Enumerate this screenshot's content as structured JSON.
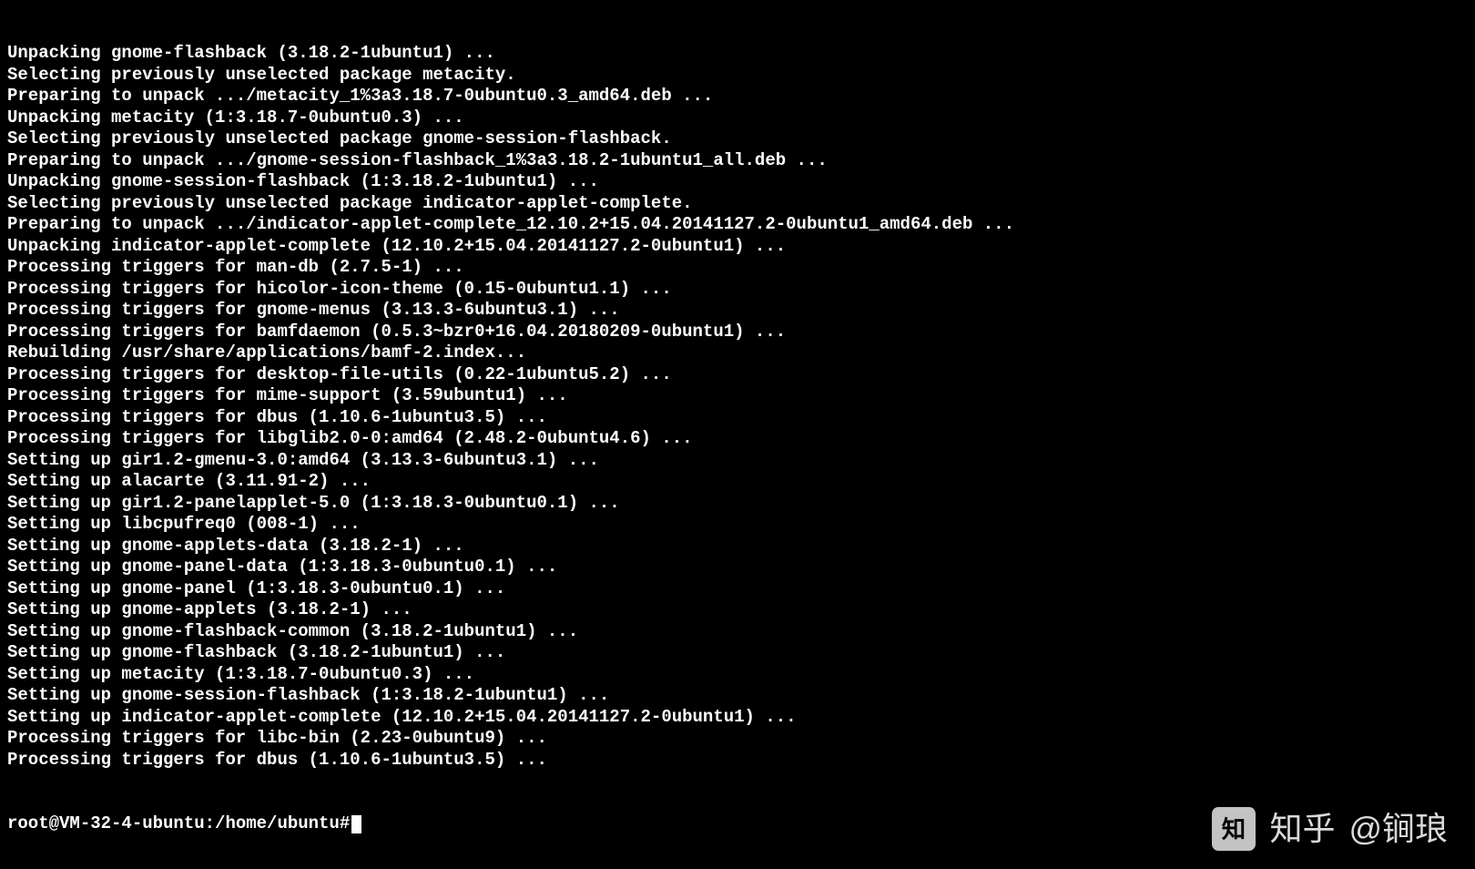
{
  "terminal": {
    "lines": [
      "Unpacking gnome-flashback (3.18.2-1ubuntu1) ...",
      "Selecting previously unselected package metacity.",
      "Preparing to unpack .../metacity_1%3a3.18.7-0ubuntu0.3_amd64.deb ...",
      "Unpacking metacity (1:3.18.7-0ubuntu0.3) ...",
      "Selecting previously unselected package gnome-session-flashback.",
      "Preparing to unpack .../gnome-session-flashback_1%3a3.18.2-1ubuntu1_all.deb ...",
      "Unpacking gnome-session-flashback (1:3.18.2-1ubuntu1) ...",
      "Selecting previously unselected package indicator-applet-complete.",
      "Preparing to unpack .../indicator-applet-complete_12.10.2+15.04.20141127.2-0ubuntu1_amd64.deb ...",
      "Unpacking indicator-applet-complete (12.10.2+15.04.20141127.2-0ubuntu1) ...",
      "Processing triggers for man-db (2.7.5-1) ...",
      "Processing triggers for hicolor-icon-theme (0.15-0ubuntu1.1) ...",
      "Processing triggers for gnome-menus (3.13.3-6ubuntu3.1) ...",
      "Processing triggers for bamfdaemon (0.5.3~bzr0+16.04.20180209-0ubuntu1) ...",
      "Rebuilding /usr/share/applications/bamf-2.index...",
      "Processing triggers for desktop-file-utils (0.22-1ubuntu5.2) ...",
      "Processing triggers for mime-support (3.59ubuntu1) ...",
      "Processing triggers for dbus (1.10.6-1ubuntu3.5) ...",
      "Processing triggers for libglib2.0-0:amd64 (2.48.2-0ubuntu4.6) ...",
      "Setting up gir1.2-gmenu-3.0:amd64 (3.13.3-6ubuntu3.1) ...",
      "Setting up alacarte (3.11.91-2) ...",
      "Setting up gir1.2-panelapplet-5.0 (1:3.18.3-0ubuntu0.1) ...",
      "Setting up libcpufreq0 (008-1) ...",
      "Setting up gnome-applets-data (3.18.2-1) ...",
      "Setting up gnome-panel-data (1:3.18.3-0ubuntu0.1) ...",
      "Setting up gnome-panel (1:3.18.3-0ubuntu0.1) ...",
      "Setting up gnome-applets (3.18.2-1) ...",
      "Setting up gnome-flashback-common (3.18.2-1ubuntu1) ...",
      "Setting up gnome-flashback (3.18.2-1ubuntu1) ...",
      "Setting up metacity (1:3.18.7-0ubuntu0.3) ...",
      "Setting up gnome-session-flashback (1:3.18.2-1ubuntu1) ...",
      "Setting up indicator-applet-complete (12.10.2+15.04.20141127.2-0ubuntu1) ...",
      "Processing triggers for libc-bin (2.23-0ubuntu9) ...",
      "Processing triggers for dbus (1.10.6-1ubuntu3.5) ..."
    ],
    "prompt": "root@VM-32-4-ubuntu:/home/ubuntu#"
  },
  "watermark": {
    "brand": "知乎",
    "author": "@锏琅"
  }
}
